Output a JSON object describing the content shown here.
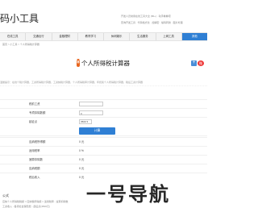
{
  "header": {
    "logo": "码小工具",
    "info_line1": "开发人员常用在线工具大全 (80+) · 动手看看吧",
    "info_line2": "查询开发工具 · 代码格式化 · 加解密 · 编码转换 · 图片处理"
  },
  "nav": {
    "items": [
      {
        "label": "在线工具"
      },
      {
        "label": "交通出行"
      },
      {
        "label": "金融理财"
      },
      {
        "label": "教育学习"
      },
      {
        "label": "休闲娱乐"
      },
      {
        "label": "生活服务"
      },
      {
        "label": "上网工具"
      },
      {
        "label": "其他"
      }
    ],
    "active_index": 7
  },
  "breadcrumb": "首页 > 小工具 > 个人所得税计算器",
  "page": {
    "title": "个人所得税计算器",
    "icon": "tax-calculator-icon",
    "description": "温馨提示：在线个税计算器，工资所得税计算器，工资纳税计算器，个人所得税率计算器，年终奖个人所得税计算器，税后工资计算器"
  },
  "share": {
    "plus_icon": "+",
    "weibo_icon": "微"
  },
  "form": {
    "rows": [
      {
        "label": "税前工资",
        "value": ""
      },
      {
        "label": "专项扣除数额",
        "value": "0"
      },
      {
        "label": "起征点",
        "value": "3500"
      }
    ],
    "select_value": "3500",
    "calc_button": "计算"
  },
  "results": {
    "rows": [
      {
        "label": "应纳税所得额",
        "value": "0 元"
      },
      {
        "label": "适用税率",
        "value": "0 %"
      },
      {
        "label": "速算扣除数",
        "value": "0 元"
      },
      {
        "label": "应纳税额",
        "value": "0 元"
      },
      {
        "label": "税后收入",
        "value": "0 元"
      }
    ]
  },
  "footer": {
    "section_title": "公式",
    "line1": "应纳个人所得税税额 = 应纳税所得额 × 适用税率 - 速算扣除数",
    "line2": "工资收入 - 各项社会保险费 - 起征点(3500元)"
  },
  "watermark": "一号导航",
  "colors": {
    "accent": "#2f7fd4",
    "icon_orange": "#e8651d"
  }
}
